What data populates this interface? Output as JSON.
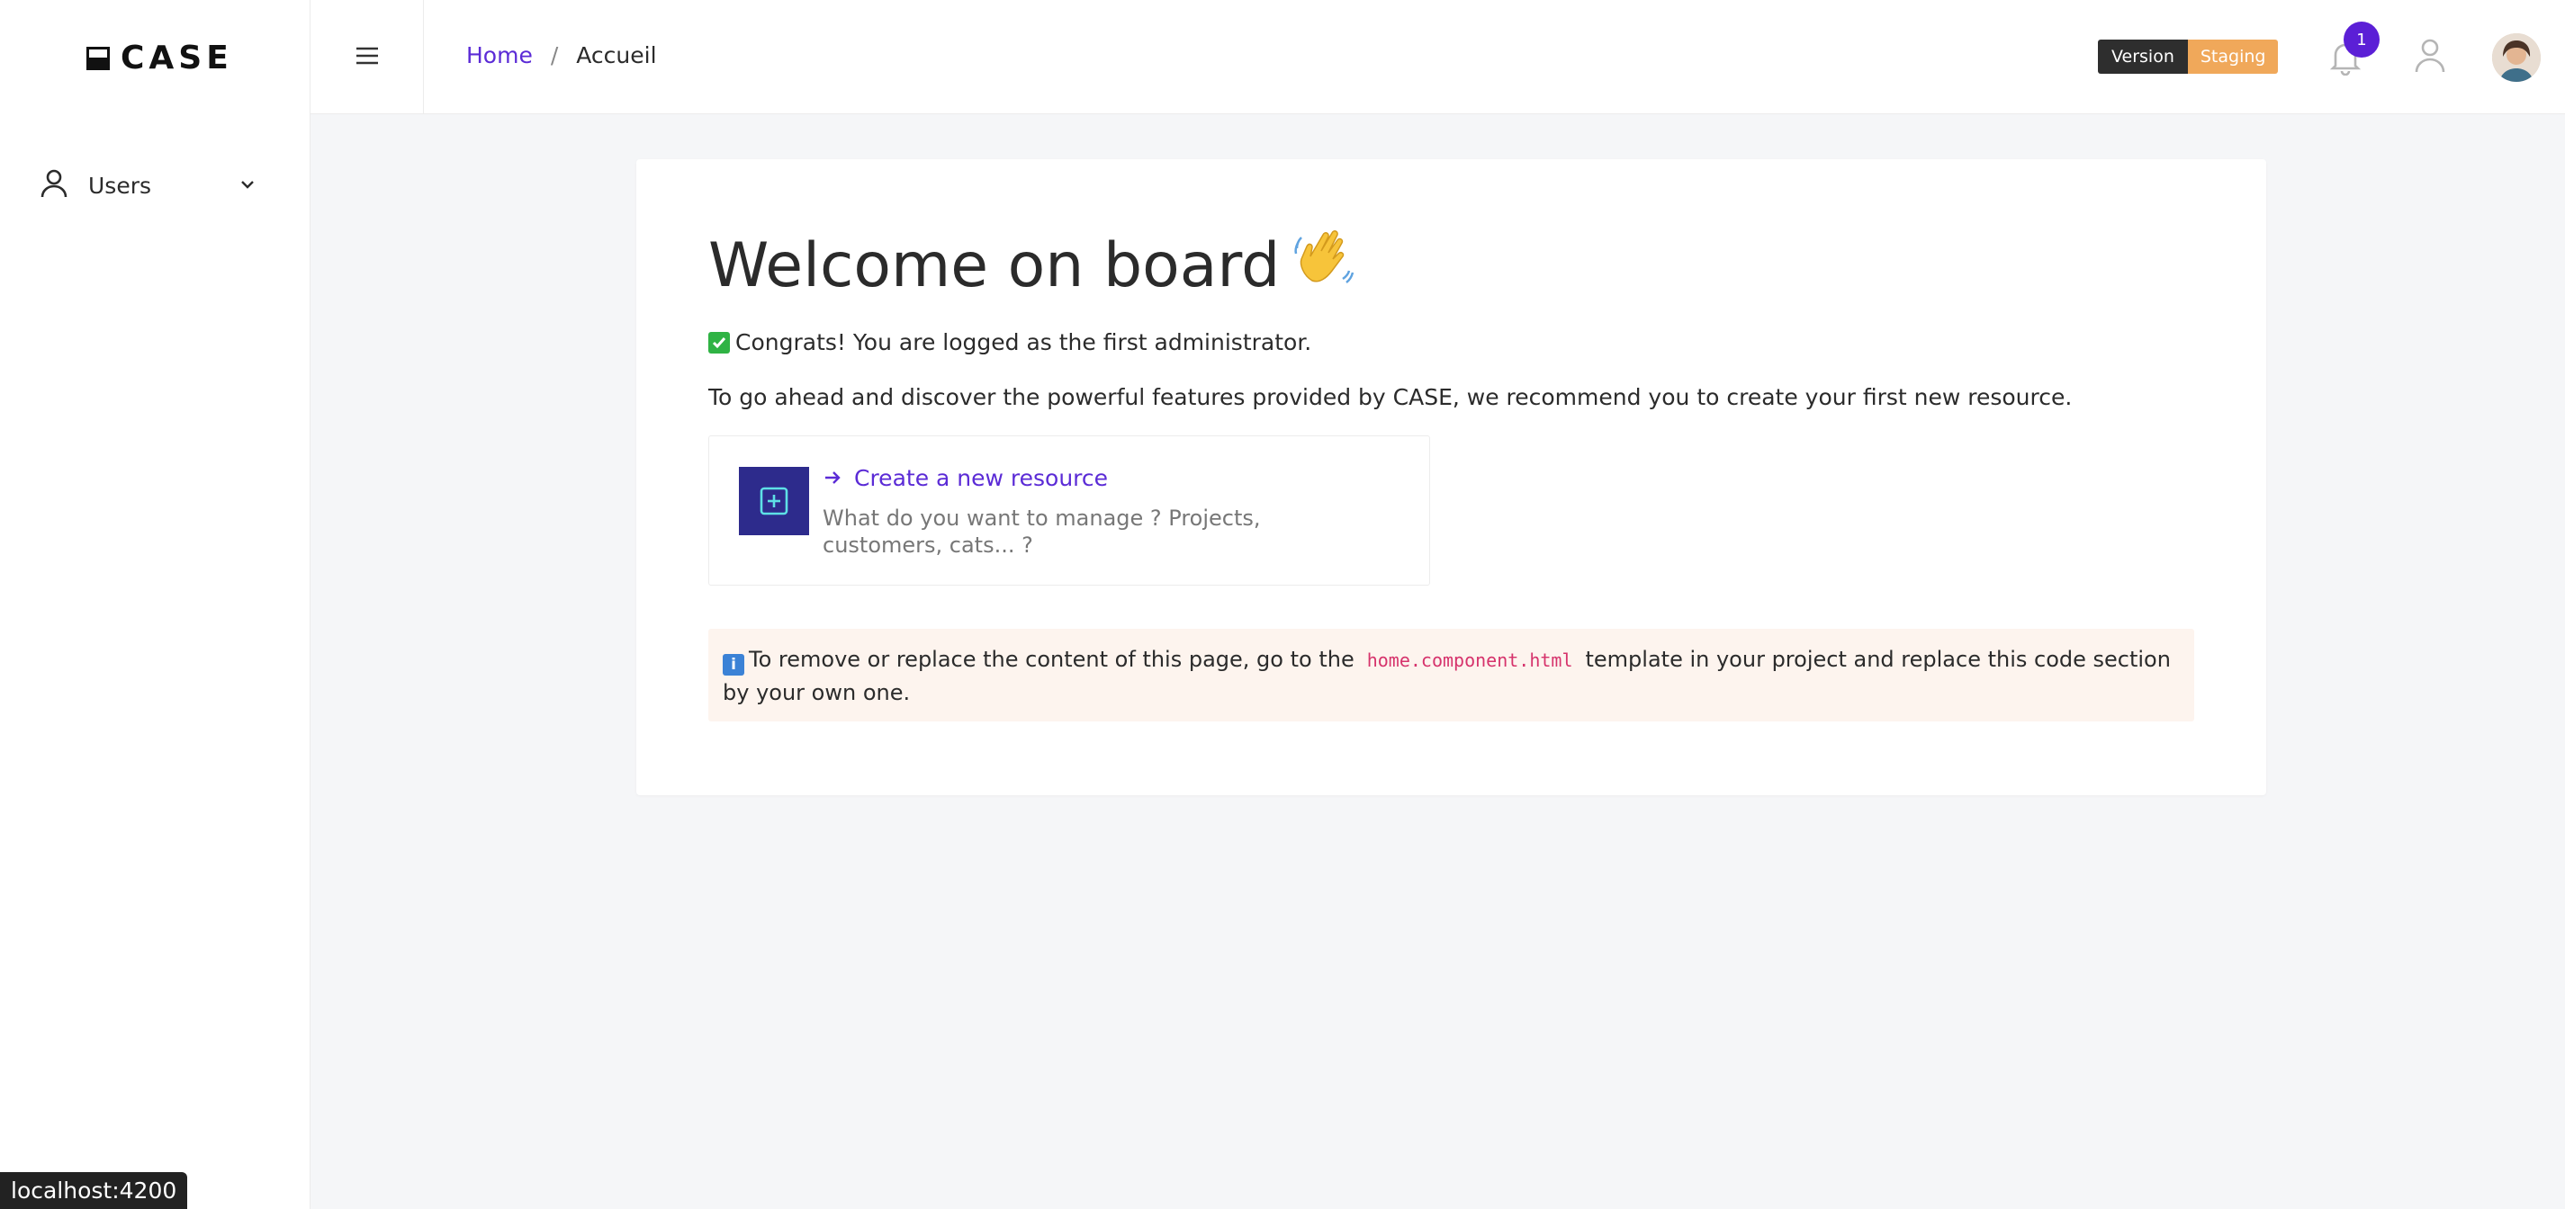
{
  "sidebar": {
    "logo_text": "CASE",
    "items": [
      {
        "label": "Users",
        "icon": "user-icon",
        "expand_icon": "chevron-down-icon"
      }
    ]
  },
  "topbar": {
    "menu_icon": "hamburger-icon",
    "breadcrumb": {
      "home": "Home",
      "separator": "/",
      "current": "Accueil"
    },
    "version_label": "Version",
    "environment": "Staging",
    "notifications_count": "1",
    "icons": [
      "bell-icon",
      "user-icon",
      "avatar"
    ]
  },
  "main": {
    "title": "Welcome on board",
    "title_emoji": "waving-hand-icon",
    "congrats": "Congrats! You are logged as the first administrator.",
    "intro": "To go ahead and discover the powerful features provided by CASE, we recommend you to create your first new resource.",
    "resource_card": {
      "link": "Create a new resource",
      "description": "What do you want to manage ? Projects, customers, cats... ?"
    },
    "notice": {
      "before": "To remove or replace the content of this page, go to the",
      "code": "home.component.html",
      "after": "template in your project and replace this code section by your own one."
    }
  },
  "status_bar": {
    "url": "localhost:4200"
  },
  "colors": {
    "accent": "#5b2bd6",
    "badge": "#5b1fd6",
    "staging": "#f0a85a",
    "tile": "#2d2b8c",
    "notice_bg": "#fdf4ee",
    "code": "#d6336c"
  }
}
